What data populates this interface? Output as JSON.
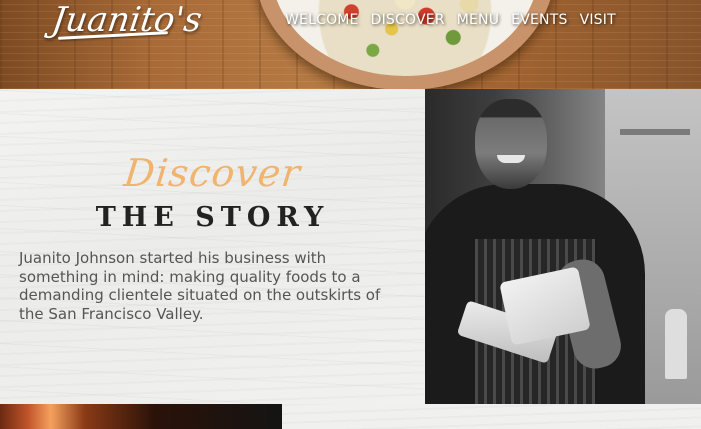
{
  "header": {
    "logo": "Juanito's",
    "nav": [
      "WELCOME",
      "DISCOVER",
      "MENU",
      "EVENTS",
      "VISIT"
    ]
  },
  "story": {
    "script_heading": "Discover",
    "title": "THE STORY",
    "body": "Juanito Johnson started his business with something in mind: making quality foods to a demanding clientele situated on the outskirts of the San Francisco Valley."
  },
  "colors": {
    "accent": "#f0b46f",
    "title": "#222222",
    "body_text": "#555555"
  }
}
